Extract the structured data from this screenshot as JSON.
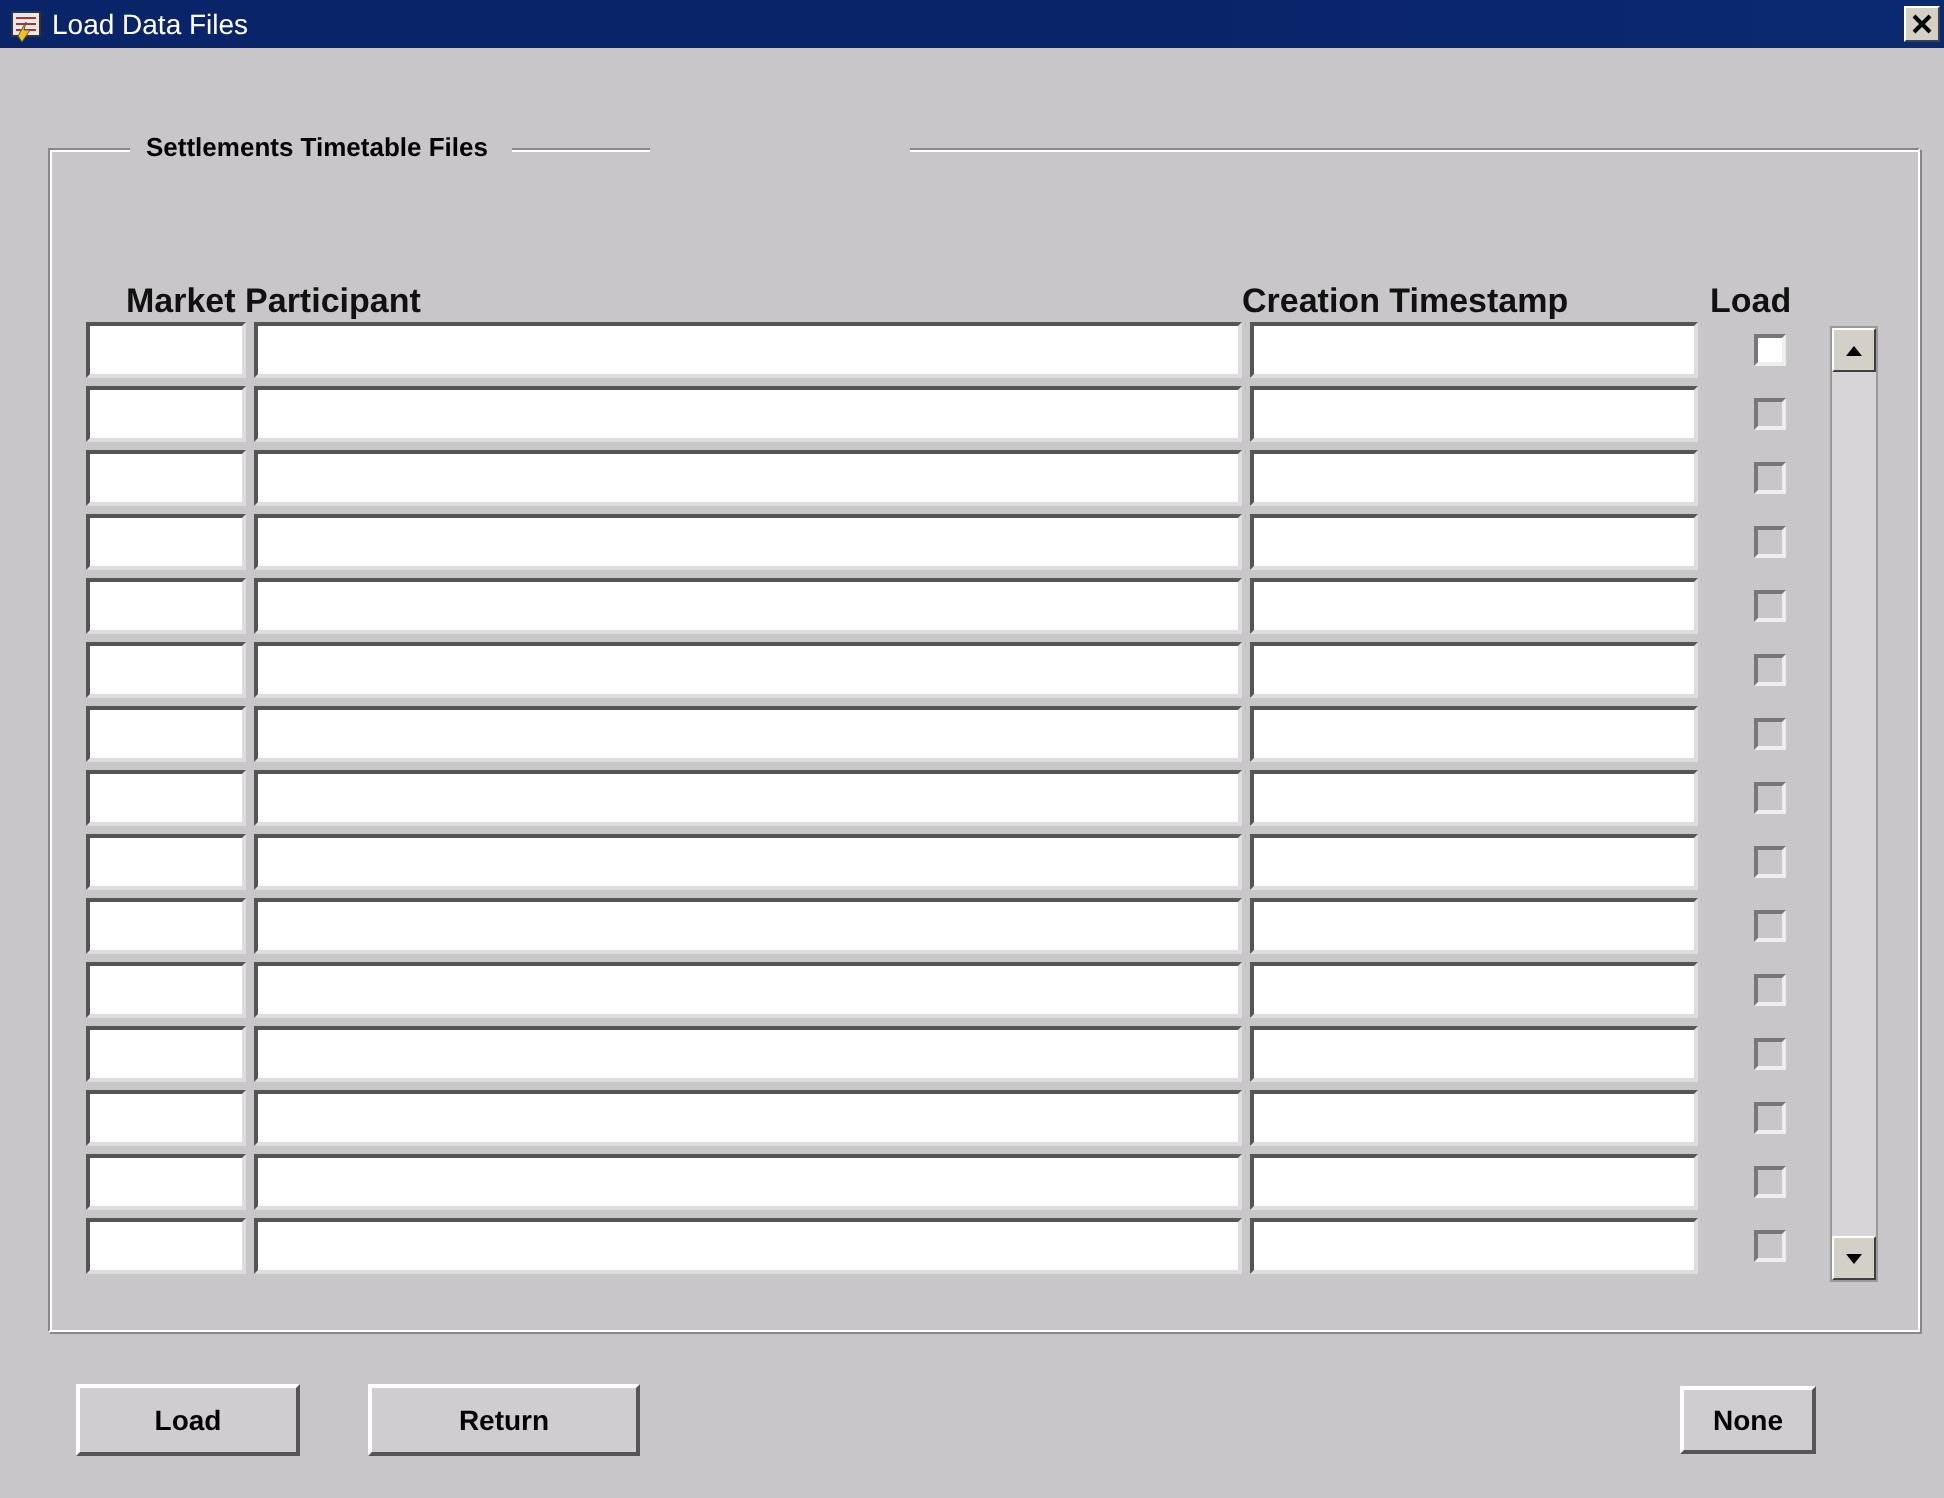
{
  "window": {
    "title": "Load Data Files"
  },
  "group": {
    "title": "Settlements Timetable Files"
  },
  "columns": [
    "Market Participant",
    "Creation Timestamp",
    "Load"
  ],
  "rows": [
    {
      "load": {
        "checked": false,
        "disabled": false
      }
    },
    {
      "load": {
        "checked": false,
        "disabled": true
      }
    },
    {
      "load": {
        "checked": false,
        "disabled": true
      }
    },
    {
      "load": {
        "checked": false,
        "disabled": true
      }
    },
    {
      "load": {
        "checked": false,
        "disabled": true
      }
    },
    {
      "load": {
        "checked": false,
        "disabled": true
      }
    },
    {
      "load": {
        "checked": false,
        "disabled": true
      }
    },
    {
      "load": {
        "checked": false,
        "disabled": true
      }
    },
    {
      "load": {
        "checked": false,
        "disabled": true
      }
    },
    {
      "load": {
        "checked": false,
        "disabled": true
      }
    },
    {
      "load": {
        "checked": false,
        "disabled": true
      }
    },
    {
      "load": {
        "checked": false,
        "disabled": true
      }
    },
    {
      "load": {
        "checked": false,
        "disabled": true
      }
    },
    {
      "load": {
        "checked": false,
        "disabled": true
      }
    },
    {
      "load": {
        "checked": false,
        "disabled": true
      }
    }
  ],
  "buttons": [
    "Load",
    "Return"
  ],
  "right_button": "None"
}
